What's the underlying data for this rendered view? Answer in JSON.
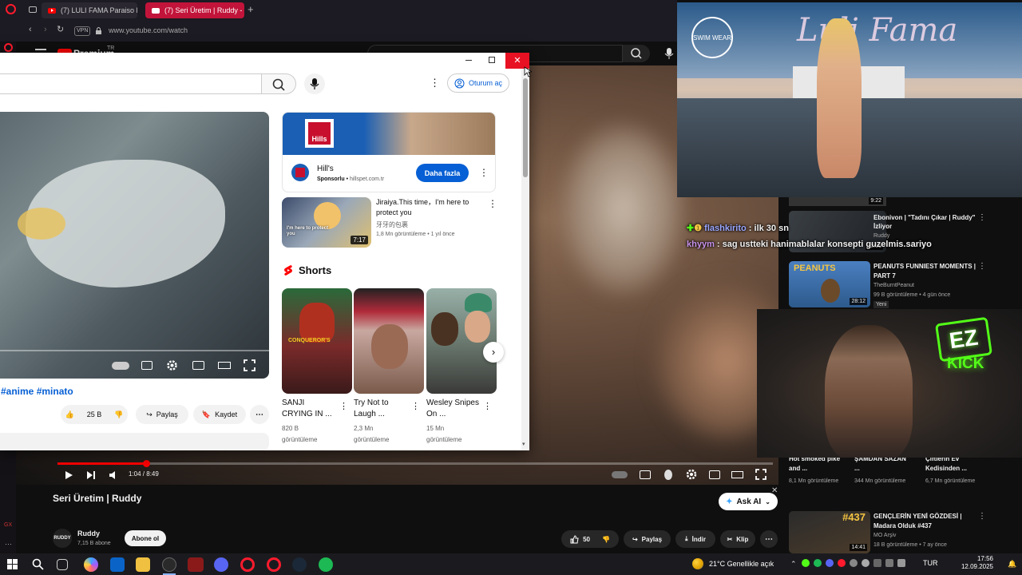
{
  "browser": {
    "tabs": [
      {
        "title": "(7) LULI FAMA Paraiso Mi",
        "active": false
      },
      {
        "title": "(7) Seri Üretim | Ruddy -",
        "active": true
      }
    ],
    "vpn_label": "VPN",
    "url": "www.youtube.com/watch",
    "premium_label": "Premium",
    "premium_region": "TR"
  },
  "popup": {
    "signin_label": "Oturum aç",
    "hashtags": "#anime #minato",
    "likes": "25 B",
    "share_label": "Paylaş",
    "save_label": "Kaydet",
    "ad": {
      "brand": "Hill's",
      "banner_text": "Hills",
      "sponsored": "Sponsorlu",
      "domain": "hillspet.com.tr",
      "cta": "Daha fazla"
    },
    "video": {
      "title": "Jiraiya.This time，I'm here to protect you",
      "channel": "牙牙的包裹",
      "meta": "1,8 Mn görüntüleme • 1 yıl önce",
      "duration": "7:17",
      "caption": "I'm here to protect you"
    },
    "shorts_title": "Shorts",
    "shorts": [
      {
        "title": "SANJI CRYING IN ...",
        "views": "820 B görüntüleme",
        "badge": "CONQUEROR'S"
      },
      {
        "title": "Try Not to Laugh ...",
        "views": "2,3 Mn görüntüleme"
      },
      {
        "title": "Wesley Snipes On ...",
        "views": "15 Mn görüntüleme"
      }
    ]
  },
  "main": {
    "video_title": "Seri Üretim | Ruddy",
    "time": "1:04 / 8:49",
    "progress": 0.124,
    "channel": "Ruddy",
    "subs": "7,15 B abone",
    "subscribe_label": "Abone ol",
    "likes": "50",
    "share_label": "Paylaş",
    "download_label": "İndir",
    "clip_label": "Klip",
    "ask_label": "Ask AI"
  },
  "sidebar": {
    "duration_top": "9:22",
    "items": [
      {
        "title": "Ebonivon | \"Tadını Çıkar | Ruddy\" İzliyor",
        "channel": "Ruddy",
        "meta": "... önce",
        "duration": "12:06"
      },
      {
        "title": "PEANUTS FUNNIEST MOMENTS | PART 7",
        "channel": "TheBurntPeanut",
        "meta": "99 B görüntüleme • 4 gün önce",
        "duration": "28:12",
        "badge": "Yeni",
        "thumb_text": "PEANUTS"
      },
      {
        "title": "GENÇLERİN YENİ GÖZDESİ | Madara Olduk #437",
        "channel": "MO Arşiv",
        "meta": "18 B görüntüleme • 7 ay önce",
        "duration": "14:41",
        "thumb_text": "#437"
      }
    ],
    "partial_row": [
      {
        "title": "Hot smoked pike and ...",
        "views": "8,1 Mn görüntüleme"
      },
      {
        "title": "ŞAMDAN SAZAN ...",
        "views": "344 Mn görüntüleme"
      },
      {
        "title": "Çiftlerin Ev Kedisinden ...",
        "views": "6,7 Mn görüntüleme"
      }
    ]
  },
  "chat": [
    {
      "user": "flashkirito",
      "message": " : ilk 30 sn",
      "color": "#9aa7ff"
    },
    {
      "user": "khyym",
      "message": " : sag ustteki hanimablalar konsepti guzelmis.sariyo",
      "color": "#c792ea"
    }
  ],
  "overlay": {
    "swimwear_logo": "SWIM WEAR",
    "runway_text": "Luli Fama",
    "kick_top": "EZ",
    "kick_bottom": "KICK"
  },
  "taskbar": {
    "weather": "21°C  Genellikle açık",
    "lang": "TUR",
    "time": "17:56",
    "date": "12.09.2025"
  },
  "colors": {
    "accent": "#ff0000",
    "link": "#065fd4",
    "kick": "#53fc18"
  }
}
